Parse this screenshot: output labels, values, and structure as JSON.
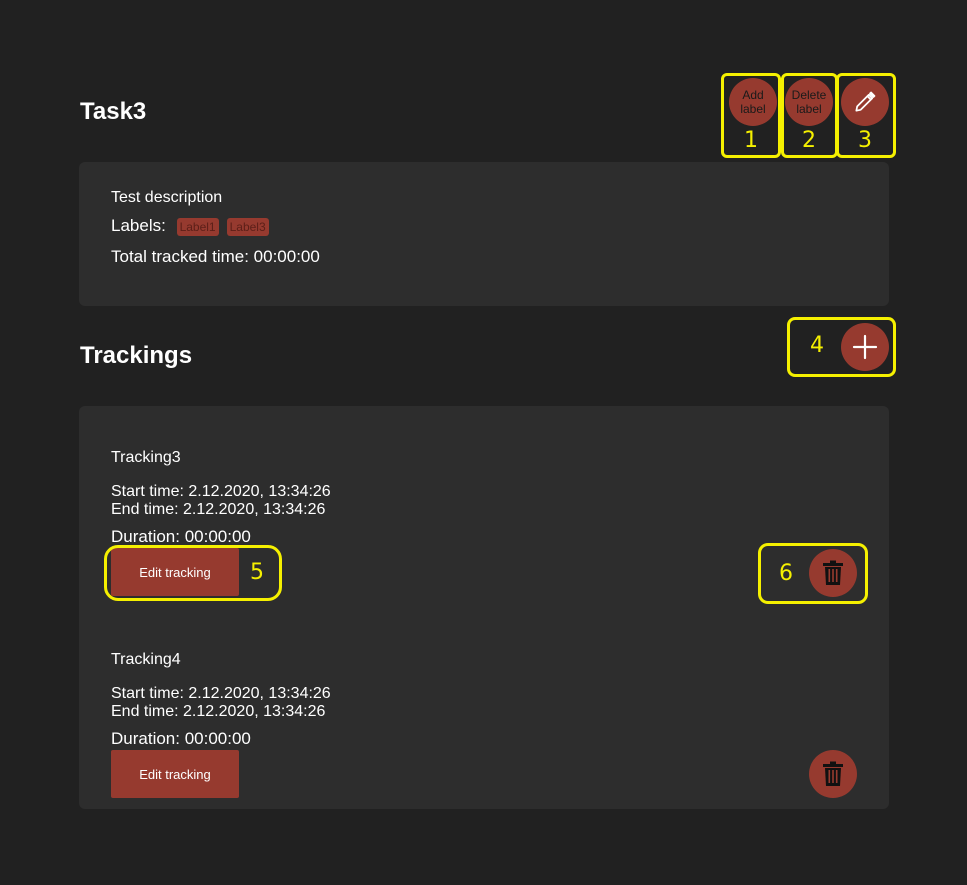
{
  "task": {
    "title": "Task3",
    "description": "Test description",
    "labels_caption": "Labels:",
    "labels": [
      "Label1",
      "Label3"
    ],
    "total_tracked": "Total tracked time: 00:00:00"
  },
  "actions": {
    "add_label_line1": "Add",
    "add_label_line2": "label",
    "delete_label_line1": "Delete",
    "delete_label_line2": "label"
  },
  "annotations": [
    "1",
    "2",
    "3",
    "4",
    "5",
    "6"
  ],
  "trackings_section": {
    "title": "Trackings"
  },
  "trackings": [
    {
      "name": "Tracking3",
      "start": "Start time: 2.12.2020, 13:34:26",
      "end": "End time: 2.12.2020, 13:34:26",
      "duration": "Duration: 00:00:00",
      "edit_label": "Edit tracking"
    },
    {
      "name": "Tracking4",
      "start": "Start time: 2.12.2020, 13:34:26",
      "end": "End time: 2.12.2020, 13:34:26",
      "duration": "Duration: 00:00:00",
      "edit_label": "Edit tracking"
    }
  ],
  "colors": {
    "background": "#212121",
    "card": "#2d2d2d",
    "accent": "#963a2f",
    "annotation": "#f5f000"
  },
  "icons": [
    "pencil-icon",
    "plus-icon",
    "trash-icon"
  ]
}
